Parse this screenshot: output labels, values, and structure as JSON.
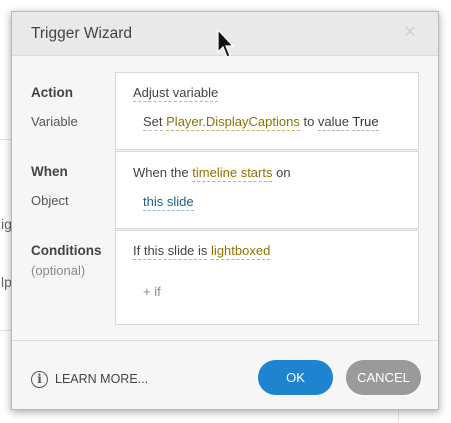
{
  "dialog": {
    "title": "Trigger Wizard",
    "close_icon": "close-icon"
  },
  "background": {
    "fragment_1": "ig",
    "fragment_2": "lp"
  },
  "action": {
    "label": "Action",
    "value": "Adjust variable",
    "variable_label": "Variable",
    "set_word": "Set",
    "variable_name": "Player.DisplayCaptions",
    "to_word": "to",
    "operator": "value",
    "variable_value": "True"
  },
  "when": {
    "label": "When",
    "object_label": "Object",
    "prefix": "When the",
    "event": "timeline starts",
    "on_word": "on",
    "object": "this slide"
  },
  "conditions": {
    "label": "Conditions",
    "sublabel": "(optional)",
    "prefix": "If this slide is",
    "state": "lightboxed",
    "add_condition": "+ if"
  },
  "footer": {
    "learn_more": "LEARN MORE...",
    "ok": "OK",
    "cancel": "CANCEL"
  },
  "colors": {
    "ok_button": "#1f84d0",
    "cancel_button": "#9a9a9a",
    "token_gold": "#8f7300",
    "token_blue": "#22618a"
  }
}
